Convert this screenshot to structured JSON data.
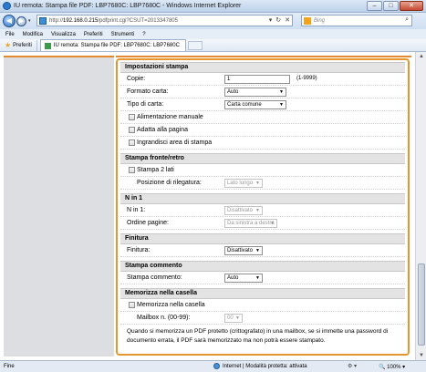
{
  "window": {
    "title": "IU remota: Stampa file PDF: LBP7680C: LBP7680C - Windows Internet Explorer",
    "minimize": "–",
    "maximize": "□",
    "close": "✕"
  },
  "nav": {
    "back": "◀",
    "forward": "▶",
    "dropdown": "▾",
    "address_host": "192.168.0.215",
    "address_prefix": "http://",
    "address_path": "/pdfprint.cgi?CSUT=2013347805",
    "refresh": "↻",
    "stop": "✕",
    "go_dropdown": "▾",
    "search_placeholder": "Bing",
    "search_icon": "⌕"
  },
  "menu": [
    "File",
    "Modifica",
    "Visualizza",
    "Preferiti",
    "Strumenti",
    "?"
  ],
  "favorites": {
    "label": "Preferiti",
    "tab_label": "IU remota: Stampa file PDF: LBP7680C: LBP7680C"
  },
  "form": {
    "print_settings": {
      "title": "Impostazioni stampa",
      "copies_label": "Copie:",
      "copies_value": "1",
      "copies_range": "(1-9999)",
      "paper_size_label": "Formato carta:",
      "paper_size_value": "Auto",
      "paper_type_label": "Tipo di carta:",
      "paper_type_value": "Carta comune",
      "manual_feed_label": "Alimentazione manuale",
      "fit_page_label": "Adatta alla pagina",
      "enlarge_area_label": "Ingrandisci area di stampa"
    },
    "duplex": {
      "title": "Stampa fronte/retro",
      "two_sided_label": "Stampa 2 lati",
      "binding_label": "Posizione di rilegatura:",
      "binding_value": "Lato lungo"
    },
    "n_in_1": {
      "title": "N in 1",
      "n_label": "N in 1:",
      "n_value": "Disattivato",
      "order_label": "Ordine pagine:",
      "order_value": "Da sinistra a destra"
    },
    "finishing": {
      "title": "Finitura",
      "label": "Finitura:",
      "value": "Disattivato"
    },
    "comment": {
      "title": "Stampa commento",
      "label": "Stampa commento:",
      "value": "Auto"
    },
    "mailbox": {
      "title": "Memorizza nella casella",
      "store_label": "Memorizza nella casella",
      "number_label": "Mailbox n. (00-99):",
      "number_value": "00",
      "note": "Quando si memorizza un PDF protetto (crittografato) in una mailbox, se si immette una password di documento errata, il PDF sarà memorizzato ma non potrà essere stampato."
    }
  },
  "status": {
    "left": "Fine",
    "zone": "Internet | Modalità protetta: attivata",
    "zoom": "100%",
    "zoom_dropdown": "▾"
  }
}
